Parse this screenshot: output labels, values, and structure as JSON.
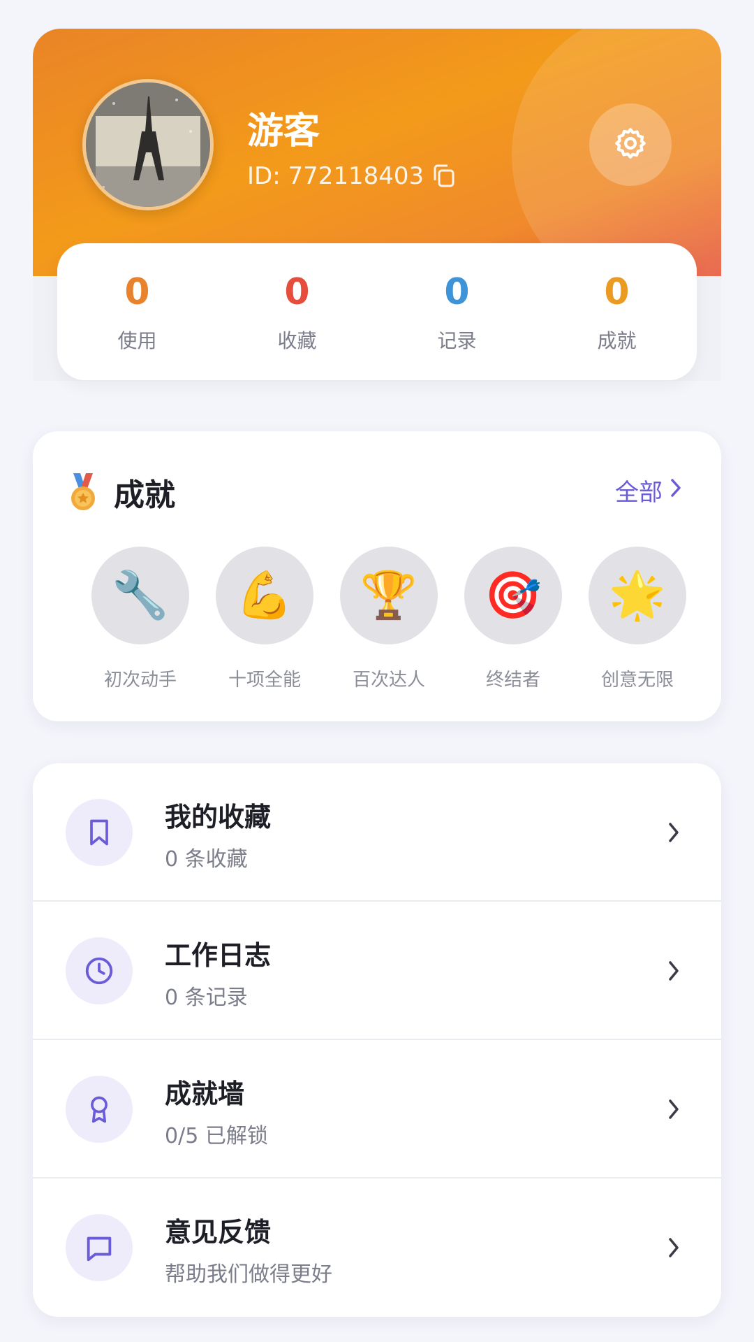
{
  "profile": {
    "name": "游客",
    "id_text": "ID: 772118403"
  },
  "stats": [
    {
      "value": "0",
      "label": "使用",
      "color": "#e8822c"
    },
    {
      "value": "0",
      "label": "收藏",
      "color": "#e54d3c"
    },
    {
      "value": "0",
      "label": "记录",
      "color": "#3f94d8"
    },
    {
      "value": "0",
      "label": "成就",
      "color": "#eb9a22"
    }
  ],
  "achievements": {
    "title": "成就",
    "all_label": "全部",
    "badges": [
      {
        "icon": "🔧",
        "label": "初次动手"
      },
      {
        "icon": "💪",
        "label": "十项全能"
      },
      {
        "icon": "🏆",
        "label": "百次达人"
      },
      {
        "icon": "🎯",
        "label": "终结者"
      },
      {
        "icon": "🌟",
        "label": "创意无限"
      }
    ]
  },
  "menu": [
    {
      "icon": "bookmark-icon",
      "title": "我的收藏",
      "subtitle": "0 条收藏"
    },
    {
      "icon": "clock-icon",
      "title": "工作日志",
      "subtitle": "0 条记录"
    },
    {
      "icon": "award-icon",
      "title": "成就墙",
      "subtitle": "0/5 已解锁"
    },
    {
      "icon": "message-icon",
      "title": "意见反馈",
      "subtitle": "帮助我们做得更好"
    }
  ],
  "colors": {
    "accent": "#6a5bd8",
    "header_start": "#ea8427",
    "header_end": "#e6553a"
  }
}
